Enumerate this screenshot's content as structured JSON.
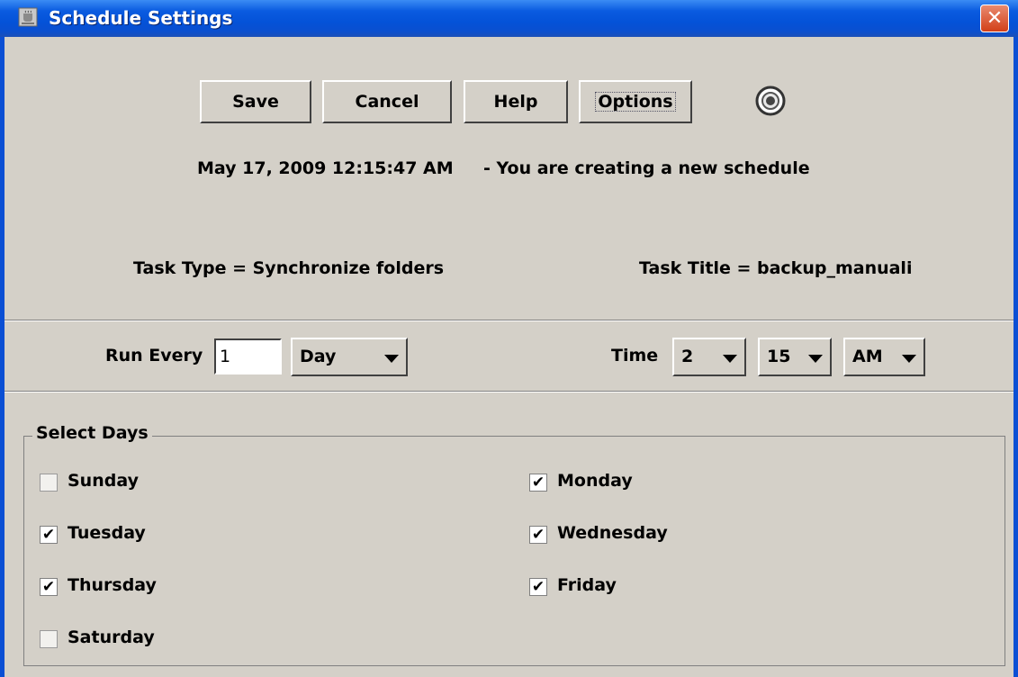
{
  "window": {
    "title": "Schedule Settings",
    "close_glyph": "✕"
  },
  "toolbar": {
    "save": "Save",
    "cancel": "Cancel",
    "help": "Help",
    "options": "Options"
  },
  "status": {
    "datetime": "May 17, 2009 12:15:47 AM",
    "message": "-  You are creating a new schedule"
  },
  "task": {
    "type": "Task Type = Synchronize folders",
    "title": "Task Title = backup_manuali"
  },
  "run": {
    "label": "Run Every",
    "value": "1",
    "unit": "Day",
    "time_label": "Time",
    "hour": "2",
    "minute": "15",
    "ampm": "AM"
  },
  "days": {
    "legend": "Select Days",
    "items": [
      {
        "label": "Sunday",
        "checked": false
      },
      {
        "label": "Monday",
        "checked": true
      },
      {
        "label": "Tuesday",
        "checked": true
      },
      {
        "label": "Wednesday",
        "checked": true
      },
      {
        "label": "Thursday",
        "checked": true
      },
      {
        "label": "Friday",
        "checked": true
      },
      {
        "label": "Saturday",
        "checked": false
      }
    ]
  },
  "icons": {
    "app": "java-cup-icon",
    "close": "close-icon",
    "radio": "radio-indicator-icon"
  },
  "colors": {
    "titlebar": "#0a5be0",
    "panel": "#d4d0c8",
    "close": "#d23f18"
  }
}
